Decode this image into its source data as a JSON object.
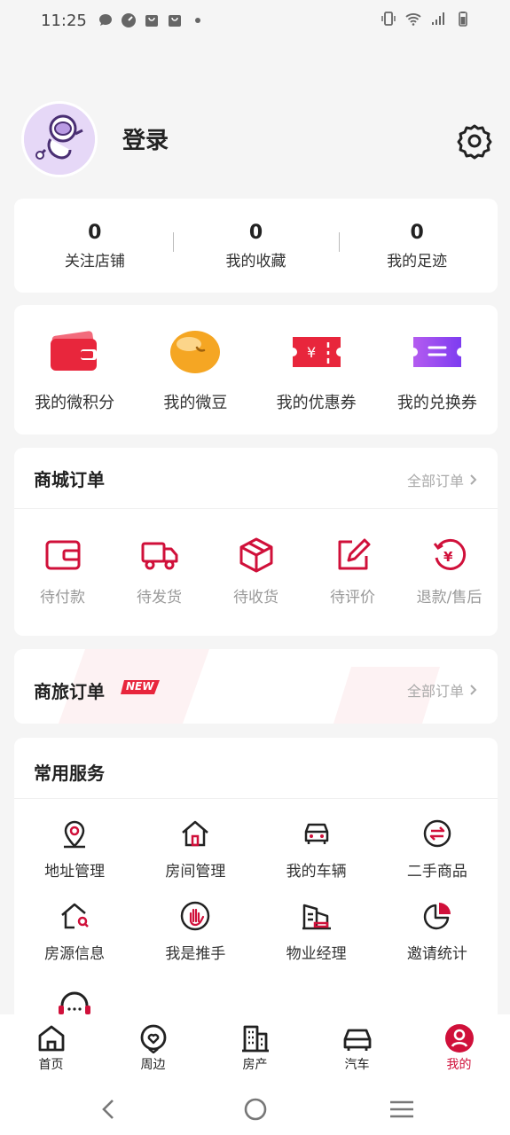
{
  "status": {
    "time": "11:25"
  },
  "profile": {
    "login": "登录"
  },
  "stats": [
    {
      "count": "0",
      "label": "关注店铺"
    },
    {
      "count": "0",
      "label": "我的收藏"
    },
    {
      "count": "0",
      "label": "我的足迹"
    }
  ],
  "assets": [
    {
      "label": "我的微积分",
      "icon": "wallet-icon"
    },
    {
      "label": "我的微豆",
      "icon": "bean-icon"
    },
    {
      "label": "我的优惠券",
      "icon": "coupon-icon"
    },
    {
      "label": "我的兑换券",
      "icon": "exchange-ticket-icon"
    }
  ],
  "mall_orders": {
    "title": "商城订单",
    "all": "全部订单",
    "items": [
      {
        "label": "待付款",
        "icon": "wallet-outline-icon"
      },
      {
        "label": "待发货",
        "icon": "truck-icon"
      },
      {
        "label": "待收货",
        "icon": "package-icon"
      },
      {
        "label": "待评价",
        "icon": "edit-icon"
      },
      {
        "label": "退款/售后",
        "icon": "refund-icon"
      }
    ]
  },
  "trip_orders": {
    "title": "商旅订单",
    "badge": "NEW",
    "all": "全部订单"
  },
  "services": {
    "title": "常用服务",
    "items": [
      {
        "label": "地址管理",
        "icon": "location-icon"
      },
      {
        "label": "房间管理",
        "icon": "home-icon"
      },
      {
        "label": "我的车辆",
        "icon": "car-icon"
      },
      {
        "label": "二手商品",
        "icon": "exchange-icon"
      },
      {
        "label": "房源信息",
        "icon": "house-search-icon"
      },
      {
        "label": "我是推手",
        "icon": "hand-icon"
      },
      {
        "label": "物业经理",
        "icon": "building-icon"
      },
      {
        "label": "邀请统计",
        "icon": "pie-chart-icon"
      }
    ]
  },
  "tabs": [
    {
      "label": "首页",
      "icon": "home-tab-icon"
    },
    {
      "label": "周边",
      "icon": "heart-tab-icon"
    },
    {
      "label": "房产",
      "icon": "building-tab-icon"
    },
    {
      "label": "汽车",
      "icon": "car-tab-icon"
    },
    {
      "label": "我的",
      "icon": "profile-tab-icon",
      "active": true
    }
  ],
  "colors": {
    "accent": "#d0103a",
    "background": "#f5f5f5"
  }
}
